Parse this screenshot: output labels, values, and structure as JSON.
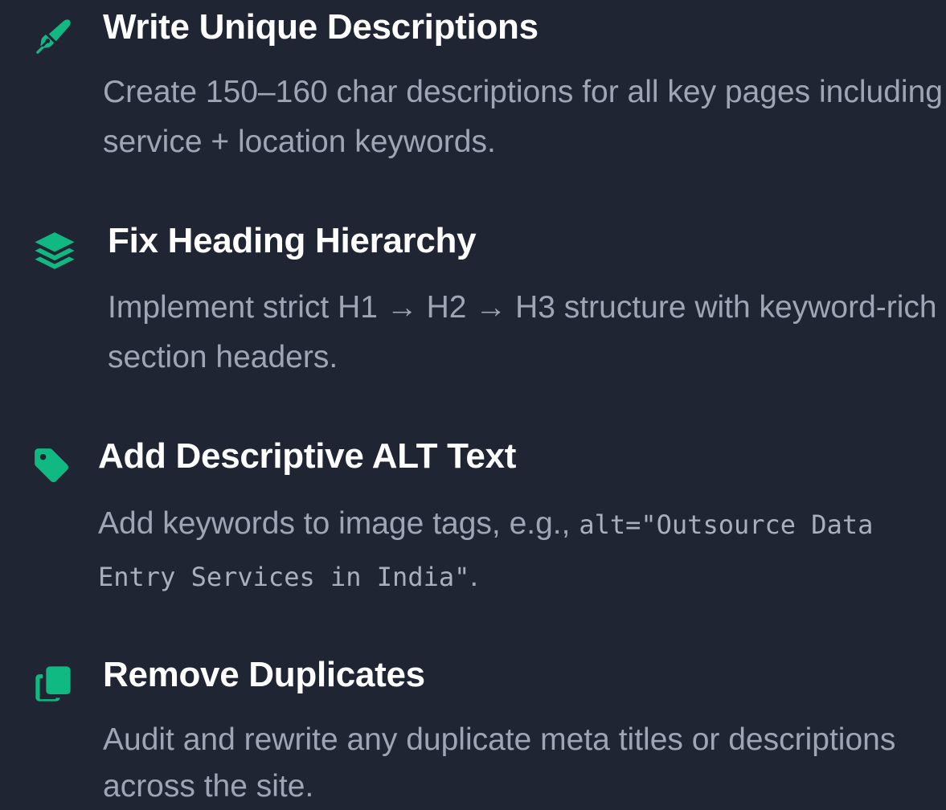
{
  "accent_color": "#10b981",
  "items": [
    {
      "icon": "pen-icon",
      "title": "Write Unique Descriptions",
      "description": "Create 150–160 char descriptions for all key pages including service + location keywords."
    },
    {
      "icon": "layers-icon",
      "title": "Fix Heading Hierarchy",
      "description": "Implement strict H1 → H2 → H3 structure with keyword-rich section headers."
    },
    {
      "icon": "tag-icon",
      "title": "Add Descriptive ALT Text",
      "description_prefix": "Add keywords to image tags, e.g., ",
      "description_code": "alt=\"Outsource Data Entry Services in India\"",
      "description_suffix": "."
    },
    {
      "icon": "copy-icon",
      "title": "Remove Duplicates",
      "description": "Audit and rewrite any duplicate meta titles or descriptions across the site."
    }
  ]
}
